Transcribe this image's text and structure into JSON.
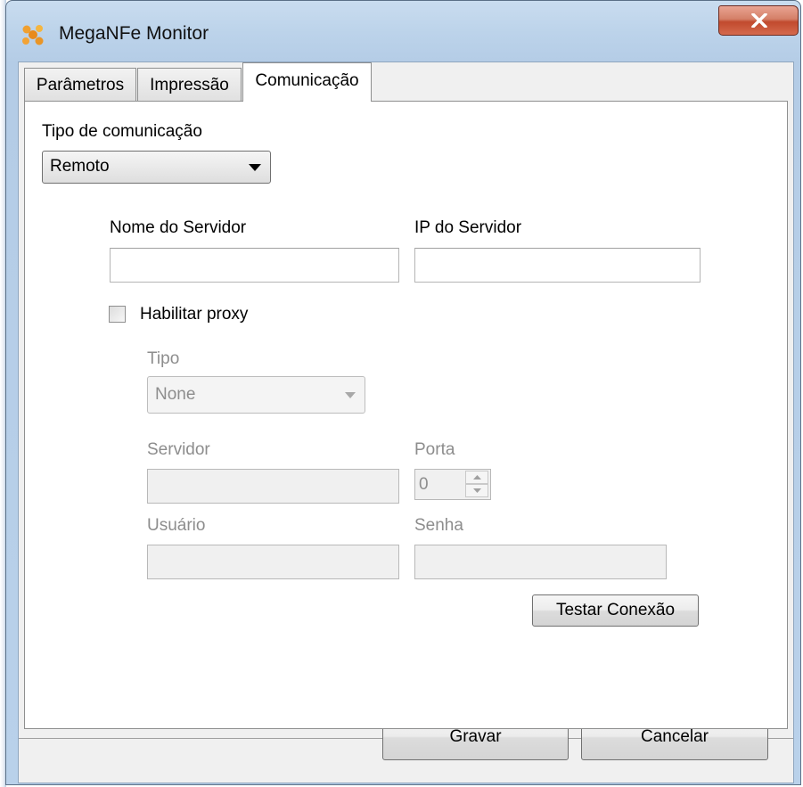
{
  "window": {
    "title": "MegaNFe Monitor",
    "icon": "meganfe-app-icon",
    "close_icon": "close-x-icon"
  },
  "tabs": [
    {
      "label": "Parâmetros",
      "active": false
    },
    {
      "label": "Impressão",
      "active": false
    },
    {
      "label": "Comunicação",
      "active": true
    }
  ],
  "communication": {
    "type_label": "Tipo de comunicação",
    "type_value": "Remoto",
    "server_name_label": "Nome do Servidor",
    "server_name_value": "",
    "server_ip_label": "IP do Servidor",
    "server_ip_value": ""
  },
  "proxy": {
    "enable_label": "Habilitar proxy",
    "enabled": false,
    "type_label": "Tipo",
    "type_value": "None",
    "server_label": "Servidor",
    "server_value": "",
    "port_label": "Porta",
    "port_value": "0",
    "user_label": "Usuário",
    "user_value": "",
    "password_label": "Senha",
    "password_value": "",
    "test_button": "Testar Conexão"
  },
  "footer": {
    "save_button": "Gravar",
    "cancel_button": "Cancelar"
  },
  "colors": {
    "title_bar": "#bcd3ea",
    "close_button": "#c14a2e",
    "client_bg": "#f0f0f0",
    "disabled_text": "#8d8d8d"
  }
}
